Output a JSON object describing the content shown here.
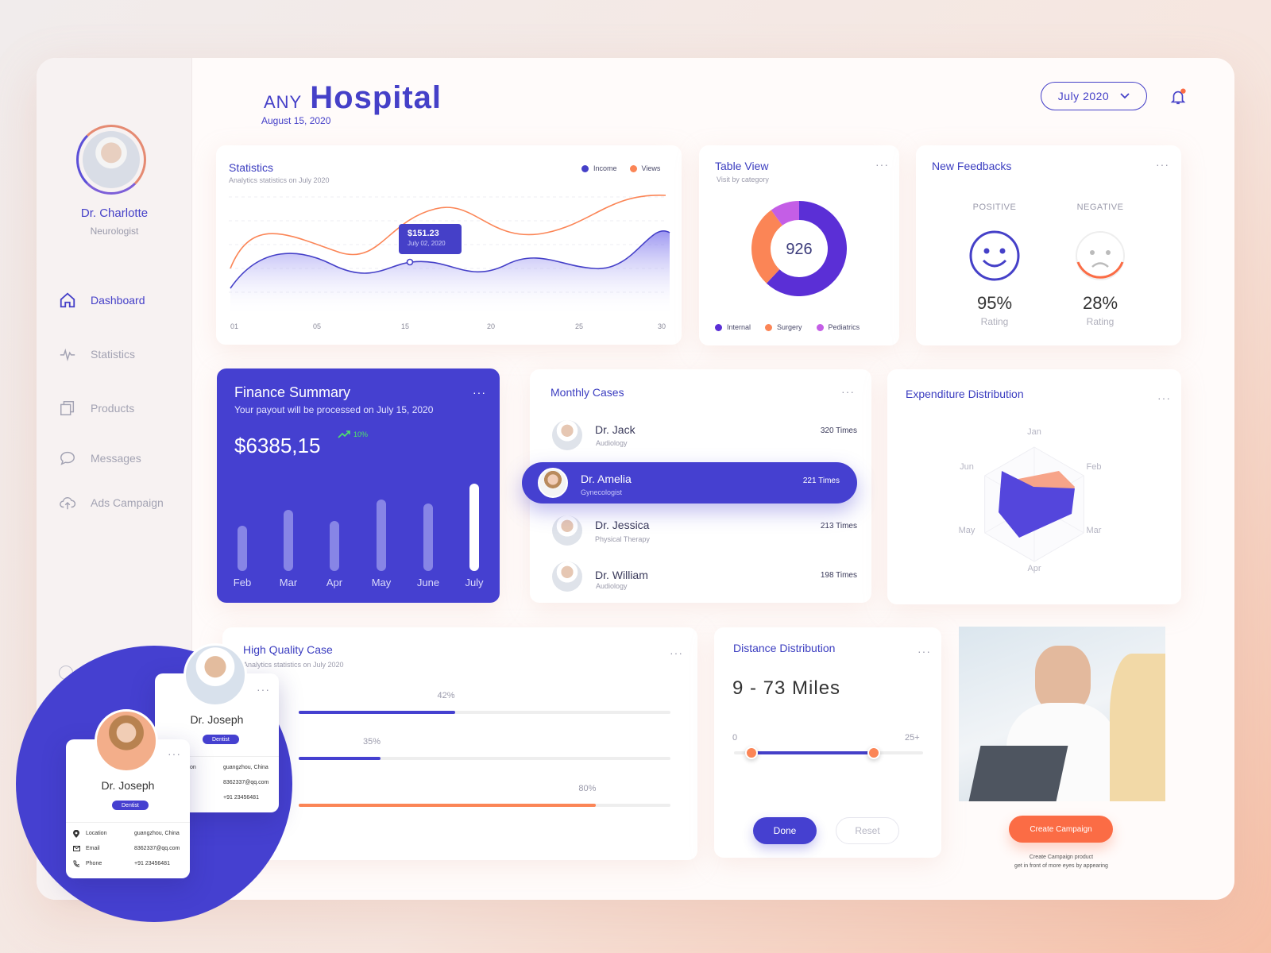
{
  "header": {
    "brand_prefix": "ANY",
    "brand": "Hospital",
    "date": "August 15, 2020",
    "month_select": "July 2020"
  },
  "profile": {
    "name": "Dr. Charlotte",
    "role": "Neurologist"
  },
  "nav": [
    {
      "label": "Dashboard",
      "icon": "home-icon",
      "active": true
    },
    {
      "label": "Statistics",
      "icon": "pulse-icon"
    },
    {
      "label": "Products",
      "icon": "copy-icon"
    },
    {
      "label": "Messages",
      "icon": "chat-icon"
    },
    {
      "label": "Ads Campaign",
      "icon": "cloud-upload-icon"
    }
  ],
  "statistics": {
    "title": "Statistics",
    "subtitle": "Analytics statistics on July 2020",
    "legend": [
      "Income",
      "Views"
    ],
    "tooltip": {
      "value": "$151.23",
      "date": "July 02, 2020"
    },
    "x_ticks": [
      "01",
      "05",
      "15",
      "20",
      "25",
      "30"
    ]
  },
  "table_view": {
    "title": "Table View",
    "subtitle": "Visit by category",
    "total": "926",
    "legend": [
      "Internal",
      "Surgery",
      "Pediatrics"
    ],
    "slices": [
      {
        "name": "Internal",
        "value": 0.62,
        "color": "#5b2fd6"
      },
      {
        "name": "Surgery",
        "value": 0.28,
        "color": "#fb8556"
      },
      {
        "name": "Pediatrics",
        "value": 0.1,
        "color": "#c45ee6"
      }
    ]
  },
  "feedbacks": {
    "title": "New Feedbacks",
    "positive": {
      "label": "POSITIVE",
      "value": "95%",
      "caption": "Rating"
    },
    "negative": {
      "label": "NEGATIVE",
      "value": "28%",
      "caption": "Rating"
    }
  },
  "finance": {
    "title": "Finance Summary",
    "subtitle": "Your payout will be processed on July 15, 2020",
    "amount": "$6385,15",
    "trend": "10%",
    "months": [
      "Feb",
      "Mar",
      "Apr",
      "May",
      "June",
      "July"
    ],
    "levels": [
      0.52,
      0.7,
      0.57,
      0.82,
      0.77,
      1.0
    ]
  },
  "monthly_cases": {
    "title": "Monthly Cases",
    "rows": [
      {
        "name": "Dr. Jack",
        "spec": "Audiology",
        "times": "320 Times"
      },
      {
        "name": "Dr. Amelia",
        "spec": "Gynecologist",
        "times": "221 Times"
      },
      {
        "name": "Dr. Jessica",
        "spec": "Physical Therapy",
        "times": "213 Times"
      },
      {
        "name": "Dr. William",
        "spec": "Audiology",
        "times": "198 Times"
      }
    ]
  },
  "expenditure": {
    "title": "Expenditure Distribution",
    "axes": [
      "Jan",
      "Feb",
      "Mar",
      "Apr",
      "May",
      "Jun"
    ]
  },
  "high_quality": {
    "title": "High Quality Case",
    "subtitle": "Analytics statistics on July 2020",
    "bars": [
      {
        "label": "42%",
        "value": 0.42,
        "color": "#4540d0"
      },
      {
        "label": "35%",
        "value": 0.22,
        "color": "#4540d0"
      },
      {
        "label": "80%",
        "value": 0.8,
        "color": "#fb8556"
      }
    ]
  },
  "distance": {
    "title": "Distance Distribution",
    "range": "9 - 73 Miles",
    "min": "0",
    "max": "25+",
    "done": "Done",
    "reset": "Reset"
  },
  "campaign": {
    "button": "Create Campaign",
    "note1": "Create Campaign product",
    "note2": "get in front of more eyes by appearing"
  },
  "profile_cards": [
    {
      "name": "Dr. Joseph",
      "badge": "Dentist",
      "location_label": "Location",
      "location": "guangzhou,  China",
      "email_label": "Email",
      "email": "8362337@qq.com",
      "phone_label": "Phone",
      "phone": "+91  23456481"
    },
    {
      "name": "Dr. Joseph",
      "badge": "Dentist",
      "location_frag": "on",
      "location": "guangzhou,  China",
      "email": "8362337@qq.com",
      "phone": "+91  23456481"
    }
  ]
}
